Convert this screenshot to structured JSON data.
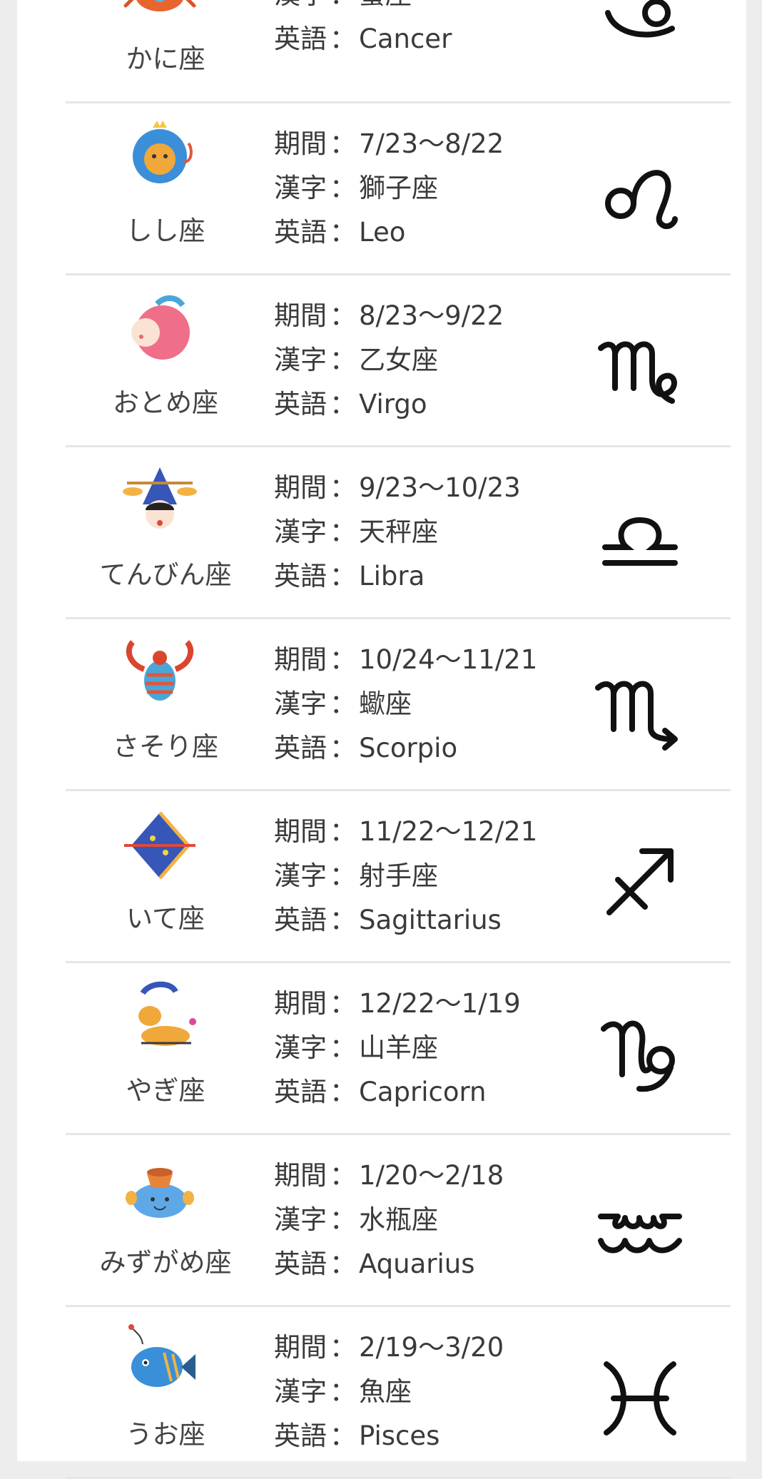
{
  "labels": {
    "period": "期間",
    "kanji": "漢字",
    "english": "英語",
    "sep": "："
  },
  "signs": [
    {
      "id": "cancer",
      "name": "かに座",
      "period": null,
      "kanji": "蟹座",
      "english": "Cancer",
      "illustration": "crab-illustration",
      "symbol": "cancer-symbol-icon"
    },
    {
      "id": "leo",
      "name": "しし座",
      "period": "7/23〜8/22",
      "kanji": "獅子座",
      "english": "Leo",
      "illustration": "lion-illustration",
      "symbol": "leo-symbol-icon"
    },
    {
      "id": "virgo",
      "name": "おとめ座",
      "period": "8/23〜9/22",
      "kanji": "乙女座",
      "english": "Virgo",
      "illustration": "maiden-illustration",
      "symbol": "virgo-symbol-icon"
    },
    {
      "id": "libra",
      "name": "てんびん座",
      "period": "9/23〜10/23",
      "kanji": "天秤座",
      "english": "Libra",
      "illustration": "scales-illustration",
      "symbol": "libra-symbol-icon"
    },
    {
      "id": "scorpio",
      "name": "さそり座",
      "period": "10/24〜11/21",
      "kanji": "蠍座",
      "english": "Scorpio",
      "illustration": "scorpion-illustration",
      "symbol": "scorpio-symbol-icon"
    },
    {
      "id": "sagittarius",
      "name": "いて座",
      "period": "11/22〜12/21",
      "kanji": "射手座",
      "english": "Sagittarius",
      "illustration": "bow-illustration",
      "symbol": "sagittarius-symbol-icon"
    },
    {
      "id": "capricorn",
      "name": "やぎ座",
      "period": "12/22〜1/19",
      "kanji": "山羊座",
      "english": "Capricorn",
      "illustration": "goat-illustration",
      "symbol": "capricorn-symbol-icon"
    },
    {
      "id": "aquarius",
      "name": "みずがめ座",
      "period": "1/20〜2/18",
      "kanji": "水瓶座",
      "english": "Aquarius",
      "illustration": "water-jar-illustration",
      "symbol": "aquarius-symbol-icon"
    },
    {
      "id": "pisces",
      "name": "うお座",
      "period": "2/19〜3/20",
      "kanji": "魚座",
      "english": "Pisces",
      "illustration": "fish-illustration",
      "symbol": "pisces-symbol-icon"
    }
  ]
}
